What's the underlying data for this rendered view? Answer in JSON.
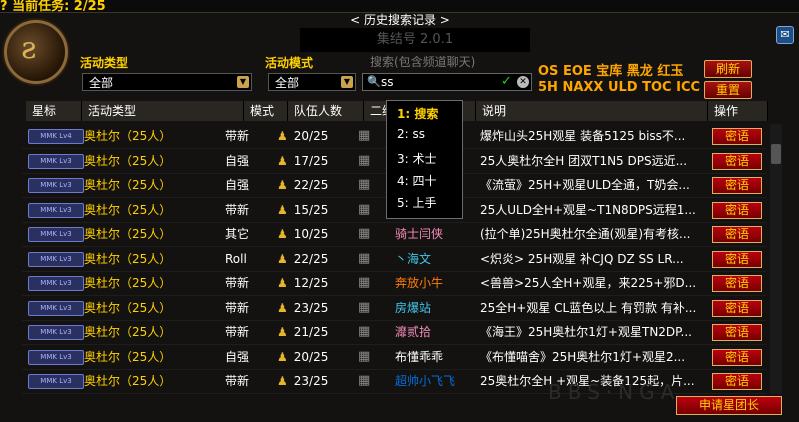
{
  "top_quest": "? 当前任务: 2/25",
  "window": {
    "title": "< 历史搜索记录 >",
    "set_number": "集结号 2.0.1"
  },
  "filters": {
    "activity_type_label": "活动类型",
    "activity_type_value": "全部",
    "mode_label": "活动模式",
    "mode_value": "全部",
    "search_hint": "搜索(包含频道聊天)",
    "search_value": "ss"
  },
  "tags_line1": "OS EOE 宝库 黑龙 红玉",
  "tags_line2": "5H NAXX ULD TOC ICC",
  "buttons": {
    "refresh": "刷新",
    "reset": "重置",
    "whisper": "密语",
    "apply_leader": "申请星团长"
  },
  "columns": [
    "星标",
    "活动类型",
    "模式",
    "队伍人数",
    "二维码",
    "",
    "说明",
    "操作"
  ],
  "history_dropdown": [
    "1: 搜索",
    "2: ss",
    "3: 术士",
    "4: 四十",
    "5: 上手"
  ],
  "rows": [
    {
      "star": "MMK Lv4",
      "activity": "奥杜尔（25人）",
      "mode": "带新",
      "team": "20/25",
      "leader": "",
      "leader_color": "#ffffff",
      "desc": "爆炸山头25H观星 装备5125 biss不..."
    },
    {
      "star": "MMK Lv3",
      "activity": "奥杜尔（25人）",
      "mode": "自强",
      "team": "17/25",
      "leader": "",
      "leader_color": "#ffffff",
      "desc": "25人奥杜尔全H 团双T1N5 DPS远近..."
    },
    {
      "star": "MMK Lv3",
      "activity": "奥杜尔（25人）",
      "mode": "自强",
      "team": "22/25",
      "leader": "",
      "leader_color": "#ffffff",
      "desc": "《流萤》25H+观星ULD全通，T奶会..."
    },
    {
      "star": "MMK Lv3",
      "activity": "奥杜尔（25人）",
      "mode": "带新",
      "team": "15/25",
      "leader": "",
      "leader_color": "#ffffff",
      "desc": "25人ULD全H+观星~T1N8DPS远程1..."
    },
    {
      "star": "MMK Lv3",
      "activity": "奥杜尔（25人）",
      "mode": "其它",
      "team": "10/25",
      "leader": "骑士闫侠",
      "leader_color": "#f58cba",
      "desc": "(拉个单)25H奥杜尔全通(观星)有考核..."
    },
    {
      "star": "MMK Lv3",
      "activity": "奥杜尔（25人）",
      "mode": "Roll",
      "team": "22/25",
      "leader": "丶海文",
      "leader_color": "#40c7eb",
      "desc": "<炽炎> 25H观星 补CJQ DZ SS LR..."
    },
    {
      "star": "MMK Lv3",
      "activity": "奥杜尔（25人）",
      "mode": "带新",
      "team": "12/25",
      "leader": "奔放小牛",
      "leader_color": "#ff7d0a",
      "desc": "<兽兽>25人全H+观星，来225+邪D..."
    },
    {
      "star": "MMK Lv3",
      "activity": "奥杜尔（25人）",
      "mode": "带新",
      "team": "23/25",
      "leader": "房爆站",
      "leader_color": "#40c7eb",
      "desc": "25全H+观星 CL蓝色以上 有罚款 有补..."
    },
    {
      "star": "MMK Lv3",
      "activity": "奥杜尔（25人）",
      "mode": "带新",
      "team": "21/25",
      "leader": "灖贰拾",
      "leader_color": "#f58cba",
      "desc": "《海王》25H奥杜尔1灯+观星TN2DP..."
    },
    {
      "star": "MMK Lv3",
      "activity": "奥杜尔（25人）",
      "mode": "自强",
      "team": "20/25",
      "leader": "布懂乖乖",
      "leader_color": "#ffffff",
      "desc": "《布懂喵舍》25H奥杜尔1灯+观星2..."
    },
    {
      "star": "MMK Lv3",
      "activity": "奥杜尔（25人）",
      "mode": "带新",
      "team": "23/25",
      "leader": "超帅小飞飞",
      "leader_color": "#0070de",
      "desc": "25奥杜尔全H +观星~装备125起，片..."
    }
  ],
  "watermark": "BBS·NGA"
}
